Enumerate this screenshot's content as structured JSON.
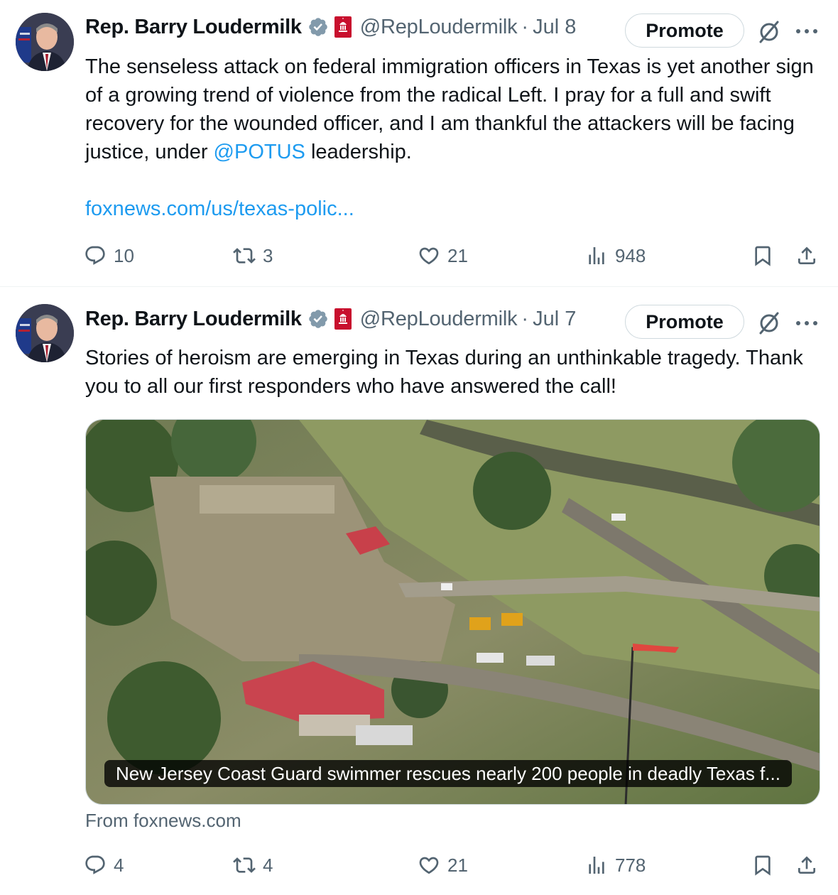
{
  "colors": {
    "link": "#1d9bf0",
    "muted": "#536471",
    "text": "#0f1419",
    "verified": "#829aab",
    "badge_red": "#c8102e"
  },
  "tweets": [
    {
      "author_name": "Rep. Barry Loudermilk",
      "handle": "@RepLoudermilk",
      "separator": "·",
      "date": "Jul 8",
      "promote_label": "Promote",
      "text_before_mention": "The senseless attack on federal immigration officers in Texas is yet another sign of a growing trend of violence from the radical Left. I pray for a full and swift recovery for the wounded officer, and I am thankful the attackers will be facing justice, under ",
      "mention": "@POTUS",
      "text_after_mention": " leadership.",
      "link": "foxnews.com/us/texas-polic...",
      "stats": {
        "replies": "10",
        "retweets": "3",
        "likes": "21",
        "views": "948"
      }
    },
    {
      "author_name": "Rep. Barry Loudermilk",
      "handle": "@RepLoudermilk",
      "separator": "·",
      "date": "Jul 7",
      "promote_label": "Promote",
      "text": "Stories of heroism are emerging in Texas during an unthinkable tragedy. Thank you to all our first responders who have answered the call!",
      "card_caption": "New Jersey Coast Guard swimmer rescues nearly 200 people in deadly Texas f...",
      "card_source": "From foxnews.com",
      "stats": {
        "replies": "4",
        "retweets": "4",
        "likes": "21",
        "views": "778"
      }
    }
  ]
}
